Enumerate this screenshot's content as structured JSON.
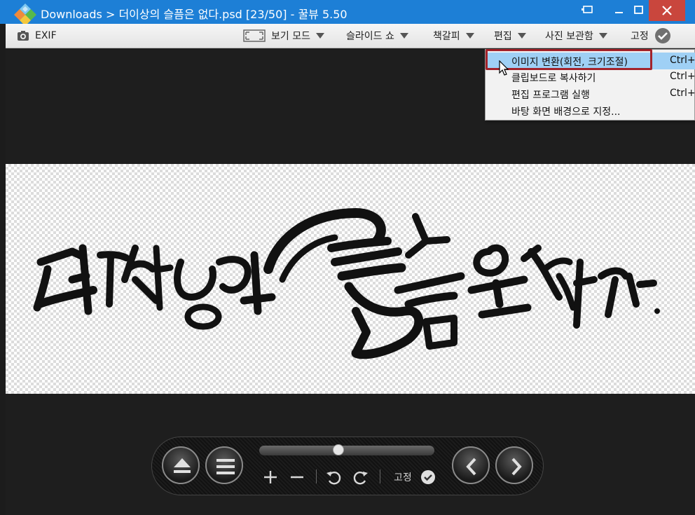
{
  "window": {
    "title": "Downloads > 더이상의 슬픔은 없다.psd [23/50] - 꿀뷰 5.50",
    "controls": {
      "minimize": "–",
      "maximize": "☐",
      "close": "✕"
    }
  },
  "toolbar": {
    "exif": "EXIF",
    "view_mode": "보기 모드",
    "slideshow": "슬라이드 쇼",
    "bookmark": "책갈피",
    "edit": "편집",
    "photo_storage": "사진 보관함",
    "pin": "고정"
  },
  "edit_menu": {
    "items": [
      {
        "label": "이미지 변환(회전, 크기조절)",
        "shortcut": "Ctrl+",
        "highlighted": true
      },
      {
        "label": "클립보드로 복사하기",
        "shortcut": "Ctrl+C"
      },
      {
        "label": "편집 프로그램 실행",
        "shortcut": "Ctrl+"
      },
      {
        "label": "바탕 화면 배경으로 지정..."
      }
    ]
  },
  "controls": {
    "pin_label": "고정",
    "slider_position": 0.45
  },
  "colors": {
    "titlebar": "#1d7fd6",
    "close_button": "#c9463d",
    "menu_highlight": "#9fd0f5",
    "annotation_box": "#a3232b"
  }
}
